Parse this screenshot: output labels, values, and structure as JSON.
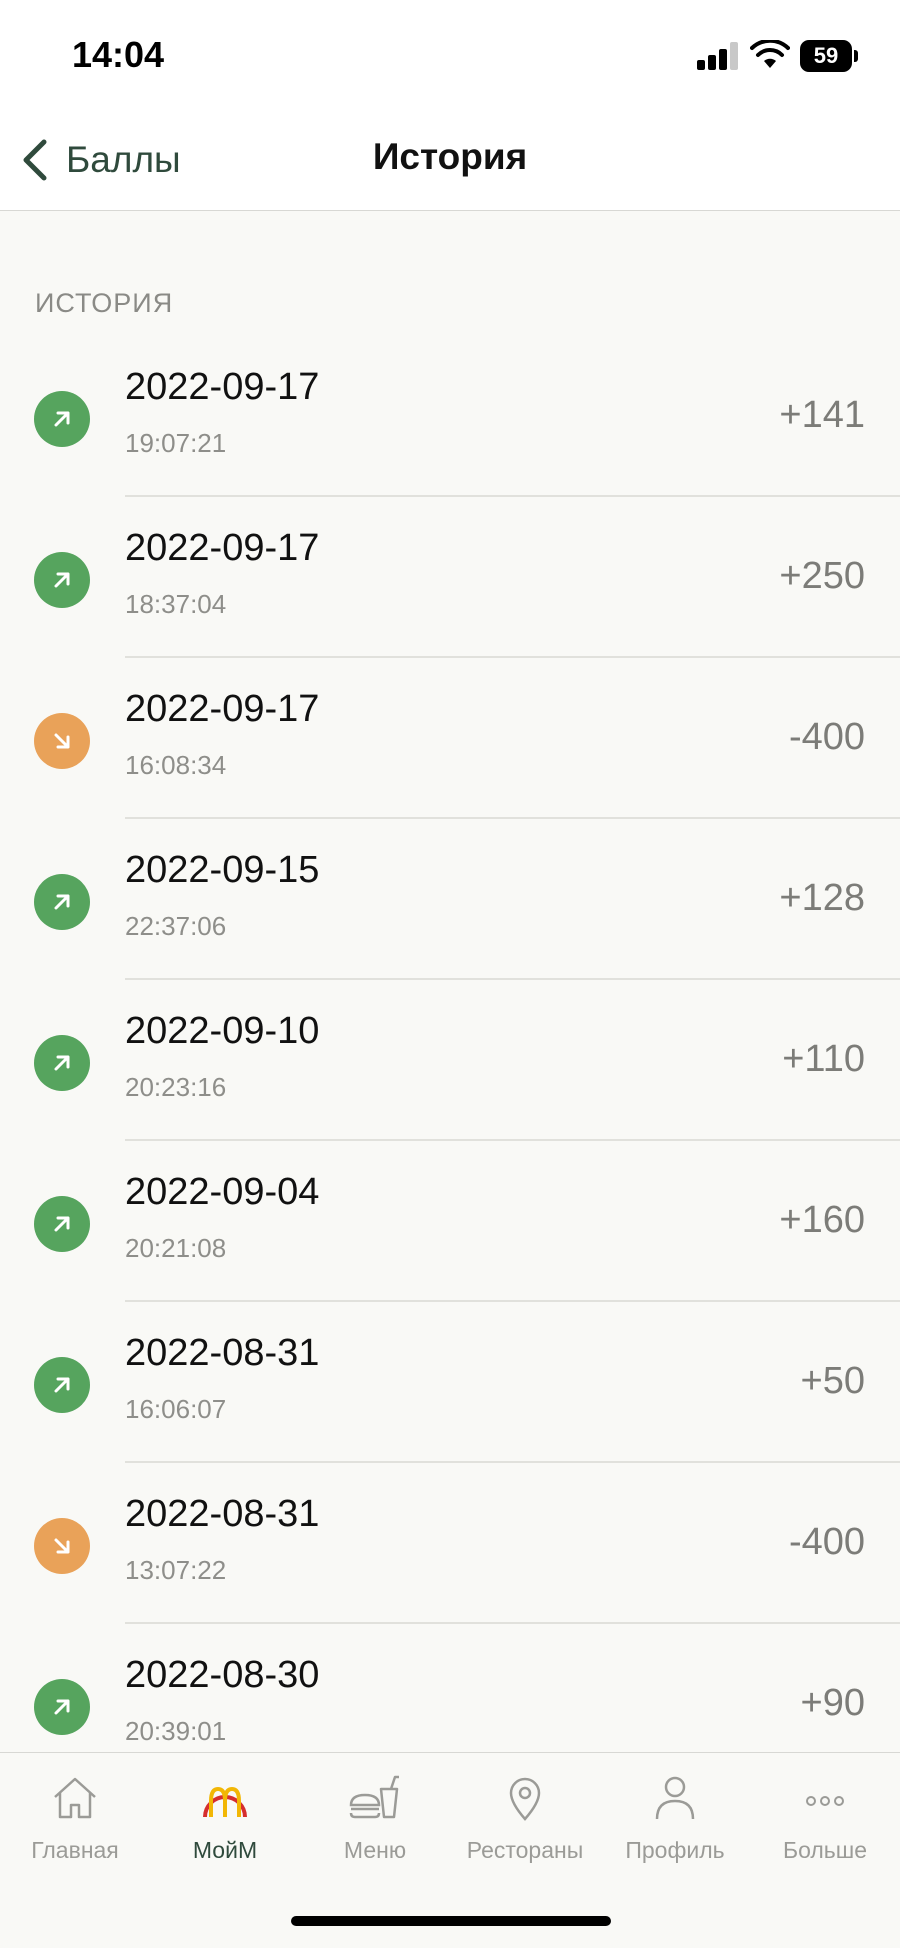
{
  "status_bar": {
    "time": "14:04",
    "battery": "59"
  },
  "header": {
    "back_label": "Баллы",
    "title": "История"
  },
  "section": {
    "title": "ИСТОРИЯ"
  },
  "history": [
    {
      "date": "2022-09-17",
      "time": "19:07:21",
      "points": "+141",
      "direction": "up"
    },
    {
      "date": "2022-09-17",
      "time": "18:37:04",
      "points": "+250",
      "direction": "up"
    },
    {
      "date": "2022-09-17",
      "time": "16:08:34",
      "points": "-400",
      "direction": "down"
    },
    {
      "date": "2022-09-15",
      "time": "22:37:06",
      "points": "+128",
      "direction": "up"
    },
    {
      "date": "2022-09-10",
      "time": "20:23:16",
      "points": "+110",
      "direction": "up"
    },
    {
      "date": "2022-09-04",
      "time": "20:21:08",
      "points": "+160",
      "direction": "up"
    },
    {
      "date": "2022-08-31",
      "time": "16:06:07",
      "points": "+50",
      "direction": "up"
    },
    {
      "date": "2022-08-31",
      "time": "13:07:22",
      "points": "-400",
      "direction": "down"
    },
    {
      "date": "2022-08-30",
      "time": "20:39:01",
      "points": "+90",
      "direction": "up"
    }
  ],
  "tabs": [
    {
      "label": "Главная",
      "icon": "home-icon",
      "active": false
    },
    {
      "label": "МойМ",
      "icon": "mcdonalds-arches-icon",
      "active": true
    },
    {
      "label": "Меню",
      "icon": "burger-drink-icon",
      "active": false
    },
    {
      "label": "Рестораны",
      "icon": "location-pin-icon",
      "active": false
    },
    {
      "label": "Профиль",
      "icon": "person-icon",
      "active": false
    },
    {
      "label": "Больше",
      "icon": "more-dots-icon",
      "active": false
    }
  ],
  "colors": {
    "accent": "#2f4a3c",
    "earn": "#56a45e",
    "spend": "#e9a259",
    "brand_yellow": "#f2b705",
    "brand_red": "#d62e2e"
  }
}
